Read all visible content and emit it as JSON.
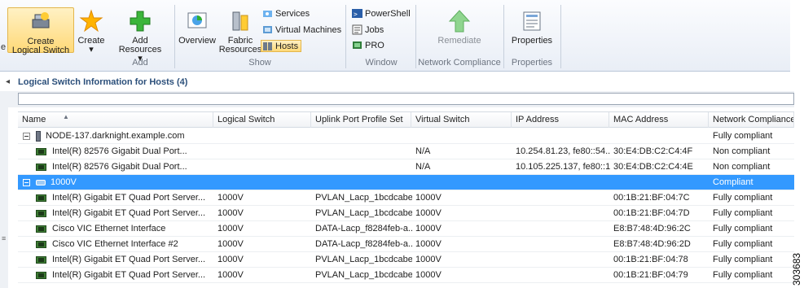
{
  "ribbon": {
    "edge_label": "e",
    "create_logical_switch": {
      "line1": "Create",
      "line2": "Logical Switch"
    },
    "create": {
      "line1": "Create",
      "caret": "▾"
    },
    "add_resources": {
      "line1": "Add",
      "line2": "Resources ▾"
    },
    "overview": "Overview",
    "fabric_resources": {
      "line1": "Fabric",
      "line2": "Resources"
    },
    "services": "Services",
    "virtual_machines": "Virtual Machines",
    "hosts": "Hosts",
    "powershell": "PowerShell",
    "jobs": "Jobs",
    "pro": "PRO",
    "remediate": "Remediate",
    "properties": "Properties",
    "groups": {
      "add": "Add",
      "show": "Show",
      "window": "Window",
      "network_compliance": "Network Compliance",
      "properties": "Properties"
    }
  },
  "panel": {
    "title": "Logical Switch Information for Hosts (4)",
    "collapse_arrow": "◂",
    "filter_placeholder": ""
  },
  "table": {
    "columns": [
      "Name",
      "Logical Switch",
      "Uplink Port Profile Set",
      "Virtual Switch",
      "IP Address",
      "MAC Address",
      "Network Compliance"
    ],
    "rows": [
      {
        "level": 0,
        "kind": "host",
        "name": "NODE-137.darknight.example.com",
        "logical_switch": "",
        "uplink": "",
        "vswitch": "",
        "ip": "",
        "mac": "",
        "compliance": "Fully compliant",
        "selected": false
      },
      {
        "level": 1,
        "kind": "nic",
        "name": "Intel(R) 82576 Gigabit Dual Port...",
        "logical_switch": "",
        "uplink": "",
        "vswitch": "N/A",
        "ip": "10.254.81.23, fe80::54...",
        "mac": "30:E4:DB:C2:C4:4F",
        "compliance": "Non compliant",
        "selected": false
      },
      {
        "level": 1,
        "kind": "nic",
        "name": "Intel(R) 82576 Gigabit Dual Port...",
        "logical_switch": "",
        "uplink": "",
        "vswitch": "N/A",
        "ip": "10.105.225.137, fe80::1...",
        "mac": "30:E4:DB:C2:C4:4E",
        "compliance": "Non compliant",
        "selected": false
      },
      {
        "level": 1,
        "kind": "switch",
        "name": "1000V",
        "logical_switch": "",
        "uplink": "",
        "vswitch": "",
        "ip": "",
        "mac": "",
        "compliance": "Compliant",
        "selected": true
      },
      {
        "level": 2,
        "kind": "nic",
        "name": "Intel(R) Gigabit ET Quad Port Server...",
        "logical_switch": "1000V",
        "uplink": "PVLAN_Lacp_1bcdcabe...",
        "vswitch": "1000V",
        "ip": "",
        "mac": "00:1B:21:BF:04:7C",
        "compliance": "Fully compliant",
        "selected": false
      },
      {
        "level": 2,
        "kind": "nic",
        "name": "Intel(R) Gigabit ET Quad Port Server...",
        "logical_switch": "1000V",
        "uplink": "PVLAN_Lacp_1bcdcabe...",
        "vswitch": "1000V",
        "ip": "",
        "mac": "00:1B:21:BF:04:7D",
        "compliance": "Fully compliant",
        "selected": false
      },
      {
        "level": 2,
        "kind": "nic",
        "name": "Cisco VIC Ethernet Interface",
        "logical_switch": "1000V",
        "uplink": "DATA-Lacp_f8284feb-a...",
        "vswitch": "1000V",
        "ip": "",
        "mac": "E8:B7:48:4D:96:2C",
        "compliance": "Fully compliant",
        "selected": false
      },
      {
        "level": 2,
        "kind": "nic",
        "name": "Cisco VIC Ethernet Interface #2",
        "logical_switch": "1000V",
        "uplink": "DATA-Lacp_f8284feb-a...",
        "vswitch": "1000V",
        "ip": "",
        "mac": "E8:B7:48:4D:96:2D",
        "compliance": "Fully compliant",
        "selected": false
      },
      {
        "level": 2,
        "kind": "nic",
        "name": "Intel(R) Gigabit ET Quad Port Server...",
        "logical_switch": "1000V",
        "uplink": "PVLAN_Lacp_1bcdcabe...",
        "vswitch": "1000V",
        "ip": "",
        "mac": "00:1B:21:BF:04:78",
        "compliance": "Fully compliant",
        "selected": false
      },
      {
        "level": 2,
        "kind": "nic",
        "name": "Intel(R) Gigabit ET Quad Port Server...",
        "logical_switch": "1000V",
        "uplink": "PVLAN_Lacp_1bcdcabe...",
        "vswitch": "1000V",
        "ip": "",
        "mac": "00:1B:21:BF:04:79",
        "compliance": "Fully compliant",
        "selected": false
      }
    ]
  },
  "side_label": "303683",
  "colors": {
    "selection": "#3399ff",
    "selection_text": "#ffffff",
    "header_bg": "#f1f3f6"
  }
}
